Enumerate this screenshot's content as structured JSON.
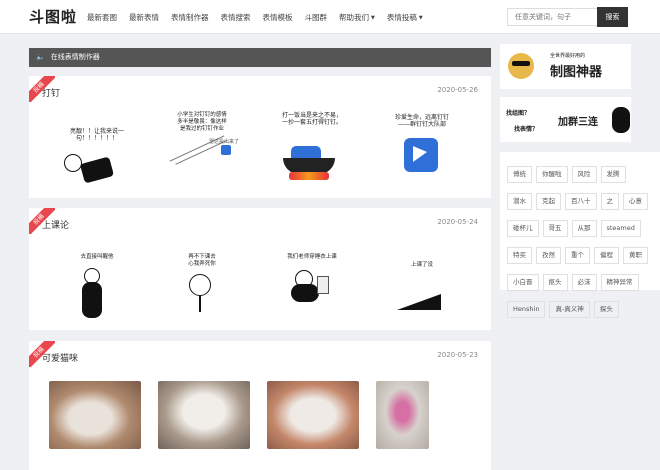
{
  "site": {
    "logo": "斗图啦"
  },
  "nav": {
    "items": [
      {
        "label": "最新套图"
      },
      {
        "label": "最新表情"
      },
      {
        "label": "表情制作器"
      },
      {
        "label": "表情搜索"
      },
      {
        "label": "表情模板"
      },
      {
        "label": "斗图群"
      },
      {
        "label": "帮助我们",
        "caret": "▼"
      },
      {
        "label": "表情投稿",
        "caret": "▼"
      }
    ]
  },
  "search": {
    "placeholder": "任意关键词，句子",
    "button": "搜索"
  },
  "banner": {
    "text": "在线表情制作器",
    "icon": "speaker-icon"
  },
  "posts": [
    {
      "ribbon": "投稿",
      "title": "打钉",
      "date": "2020-05-26",
      "captions": [
        "亮靓！！让我来说一句！！！！！！",
        "小学生对钉钉的感情\n多半是敬畏：像这样\n是我过的钉钉作业",
        "打一饭当是来之不易，\n一抄一套五打得钉钉。",
        "珍爱生命，远离钉钉\n——群钉钉大队部"
      ],
      "extra": [
        "雷达投出来了"
      ]
    },
    {
      "ribbon": "投稿",
      "title": "上课论",
      "date": "2020-05-24",
      "captions": [
        "去直接叫醒他",
        "再不下课去\n心我弄死你",
        "我们老师穿睡衣上课",
        "上课了没"
      ]
    },
    {
      "ribbon": "投稿",
      "title": "可爱猫咪",
      "date": "2020-05-23",
      "photo_colors": [
        "#b08a6e",
        "#a99a8c",
        "#c4876a",
        "#d7d2cc"
      ]
    }
  ],
  "sidebar": {
    "ads": [
      {
        "small": "全世界最好用的",
        "big": "制图神器"
      },
      {
        "q1": "找组图？",
        "q2": "找表情？",
        "big": "加群三连"
      }
    ],
    "tags": [
      "傅统",
      "你醒啦",
      "风险",
      "发腾",
      "潜水",
      "克起",
      "百八十",
      "之",
      "心意",
      "碰杯儿",
      "哥五",
      "从那",
      "steamed",
      "特买",
      "孜然",
      "重个",
      "偏程",
      "黄职",
      "小白晋",
      "抠头",
      "必沫",
      "精神异常",
      "Henshin",
      "真-真义神",
      "探头"
    ]
  },
  "colors": {
    "ribbon": "#e8474e",
    "banner": "#555555",
    "search_button": "#333333"
  }
}
